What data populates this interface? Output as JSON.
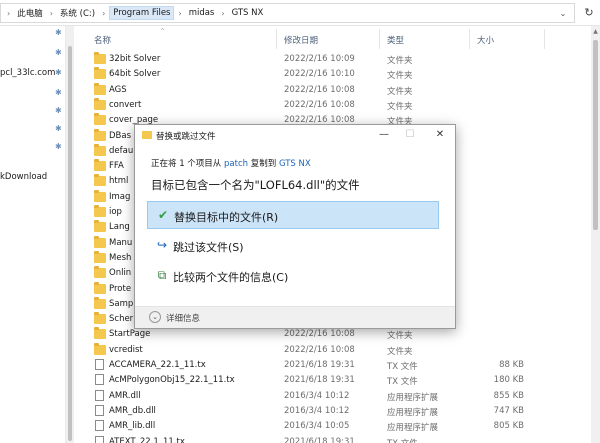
{
  "breadcrumb": [
    "此电脑",
    "系统 (C:)",
    "Program Files",
    "midas",
    "GTS NX"
  ],
  "nav": {
    "items": [
      "pcl_33lc.com",
      "kDownload"
    ]
  },
  "columns": {
    "name": "名称",
    "date": "修改日期",
    "type": "类型",
    "size": "大小"
  },
  "files": [
    {
      "name": "32bit Solver",
      "date": "2022/2/16 10:09",
      "type": "文件夹",
      "size": "",
      "kind": "folder"
    },
    {
      "name": "64bit Solver",
      "date": "2022/2/16 10:10",
      "type": "文件夹",
      "size": "",
      "kind": "folder"
    },
    {
      "name": "AGS",
      "date": "2022/2/16 10:08",
      "type": "文件夹",
      "size": "",
      "kind": "folder"
    },
    {
      "name": "convert",
      "date": "2022/2/16 10:08",
      "type": "文件夹",
      "size": "",
      "kind": "folder"
    },
    {
      "name": "cover_page",
      "date": "2022/2/16 10:08",
      "type": "文件夹",
      "size": "",
      "kind": "folder"
    },
    {
      "name": "DBas",
      "date": "",
      "type": "",
      "size": "",
      "kind": "folder"
    },
    {
      "name": "defau",
      "date": "",
      "type": "",
      "size": "",
      "kind": "folder"
    },
    {
      "name": "FFA",
      "date": "",
      "type": "",
      "size": "",
      "kind": "folder"
    },
    {
      "name": "html",
      "date": "",
      "type": "",
      "size": "",
      "kind": "folder"
    },
    {
      "name": "Imag",
      "date": "",
      "type": "",
      "size": "",
      "kind": "folder"
    },
    {
      "name": "iop",
      "date": "",
      "type": "",
      "size": "",
      "kind": "folder"
    },
    {
      "name": "Lang",
      "date": "",
      "type": "",
      "size": "",
      "kind": "folder"
    },
    {
      "name": "Manu",
      "date": "",
      "type": "",
      "size": "",
      "kind": "folder"
    },
    {
      "name": "Mesh",
      "date": "",
      "type": "",
      "size": "",
      "kind": "folder"
    },
    {
      "name": "Onlin",
      "date": "",
      "type": "",
      "size": "",
      "kind": "folder"
    },
    {
      "name": "Prote",
      "date": "",
      "type": "",
      "size": "",
      "kind": "folder"
    },
    {
      "name": "Samp",
      "date": "",
      "type": "",
      "size": "",
      "kind": "folder"
    },
    {
      "name": "Scher",
      "date": "",
      "type": "",
      "size": "",
      "kind": "folder"
    },
    {
      "name": "StartPage",
      "date": "2022/2/16 10:08",
      "type": "文件夹",
      "size": "",
      "kind": "folder"
    },
    {
      "name": "vcredist",
      "date": "2022/2/16 10:08",
      "type": "文件夹",
      "size": "",
      "kind": "folder"
    },
    {
      "name": "ACCAMERA_22.1_11.tx",
      "date": "2021/6/18 19:31",
      "type": "TX 文件",
      "size": "88 KB",
      "kind": "file"
    },
    {
      "name": "AcMPolygonObj15_22.1_11.tx",
      "date": "2021/6/18 19:31",
      "type": "TX 文件",
      "size": "180 KB",
      "kind": "file"
    },
    {
      "name": "AMR.dll",
      "date": "2016/3/4 10:12",
      "type": "应用程序扩展",
      "size": "855 KB",
      "kind": "file"
    },
    {
      "name": "AMR_db.dll",
      "date": "2016/3/4 10:12",
      "type": "应用程序扩展",
      "size": "747 KB",
      "kind": "file"
    },
    {
      "name": "AMR_lib.dll",
      "date": "2016/3/4 10:05",
      "type": "应用程序扩展",
      "size": "805 KB",
      "kind": "file"
    },
    {
      "name": "ATEXT_22.1_11.tx",
      "date": "2021/6/18 19:31",
      "type": "TX 文件",
      "size": "",
      "kind": "file"
    }
  ],
  "dialog": {
    "title": "替换或跳过文件",
    "sub_prefix": "正在将 1 个项目从",
    "source": "patch",
    "sub_mid": "复制到",
    "dest": "GTS NX",
    "message": "目标已包含一个名为\"LOFL64.dll\"的文件",
    "options": [
      {
        "label": "替换目标中的文件(R)",
        "icon": "checkmark-icon"
      },
      {
        "label": "跳过该文件(S)",
        "icon": "skip-arrow-icon"
      },
      {
        "label": "比较两个文件的信息(C)",
        "icon": "compare-icon"
      }
    ],
    "details": "详细信息"
  },
  "colors": {
    "accent": "#1a63b8",
    "selection": "#cce4f7",
    "folder": "#f4c74e"
  }
}
